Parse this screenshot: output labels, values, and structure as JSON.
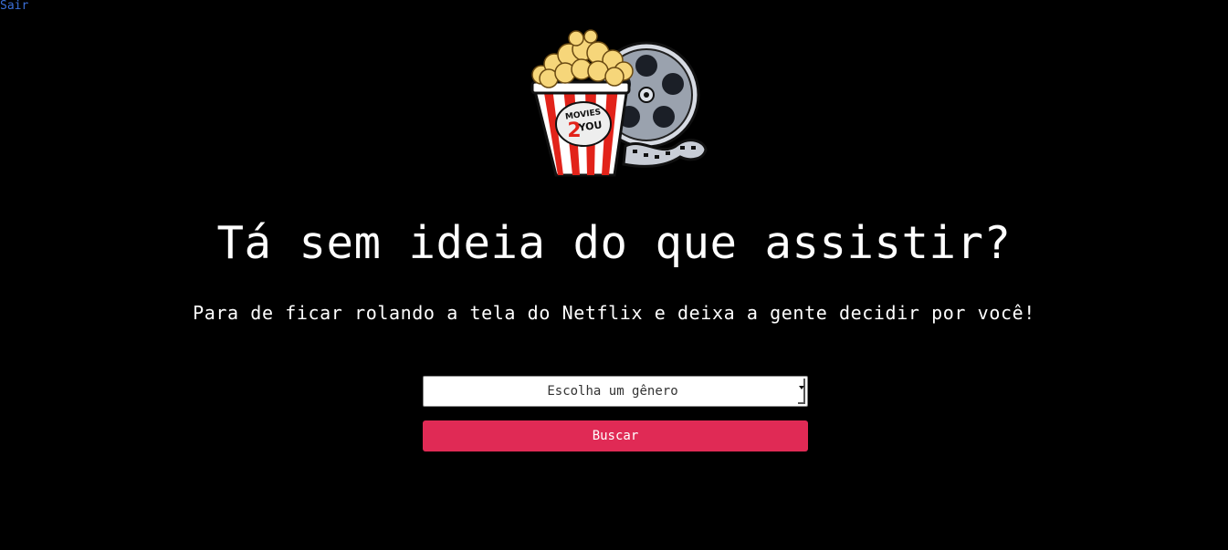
{
  "header": {
    "logout_label": "Sair"
  },
  "logo": {
    "brand_line1": "MOVIES",
    "brand_number": "2",
    "brand_line2": "YOU"
  },
  "hero": {
    "title": "Tá sem ideia do que assistir?",
    "subtitle": "Para de ficar rolando a tela do Netflix e deixa a gente decidir por você!"
  },
  "form": {
    "genre_select_value": "Escolha um gênero",
    "search_button_label": "Buscar"
  },
  "colors": {
    "background": "#000000",
    "link": "#3b6fd8",
    "button": "#e02a55",
    "text": "#ffffff"
  }
}
